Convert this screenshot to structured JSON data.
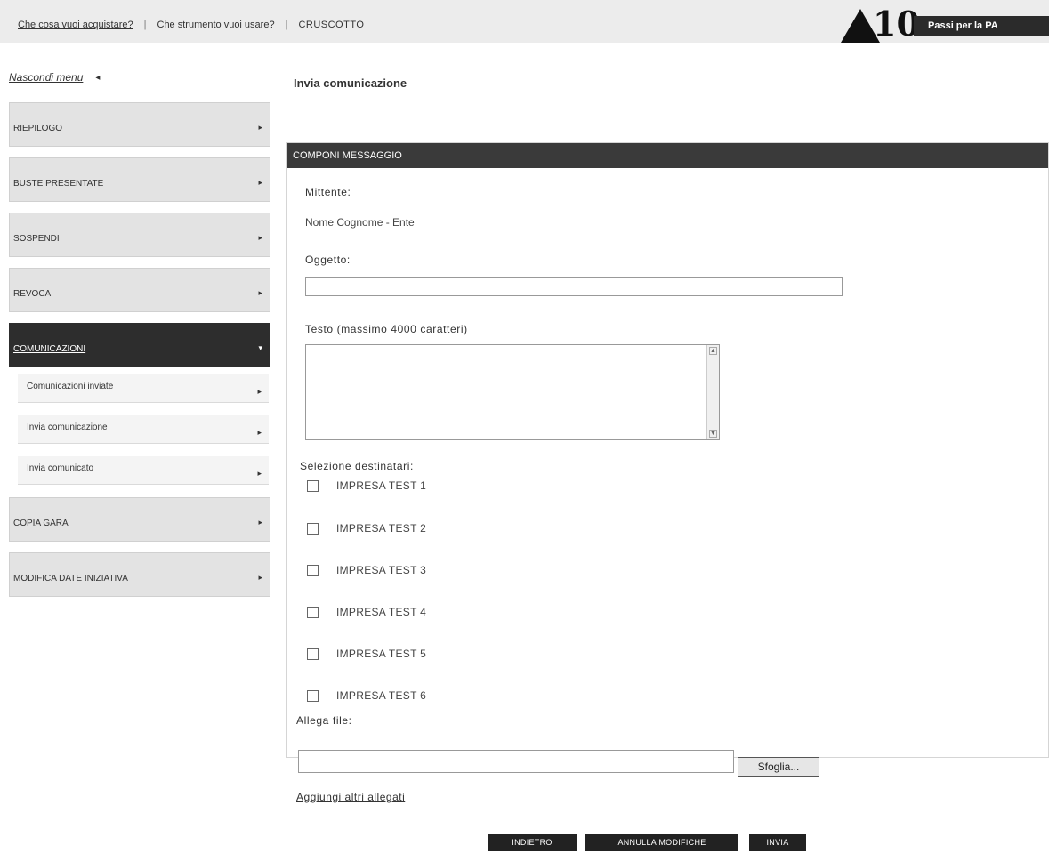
{
  "topnav": {
    "link1": "Che cosa vuoi acquistare?",
    "item2": "Che strumento vuoi usare?",
    "item3": "CRUSCOTTO",
    "separator": "|"
  },
  "logo": {
    "number": "10",
    "tagline": "Passi per la PA"
  },
  "hide_menu": {
    "label": "Nascondi menu",
    "arrow": "◂"
  },
  "sidebar": {
    "items": [
      {
        "label": "RIEPILOGO",
        "chevron": "▸"
      },
      {
        "label": "BUSTE PRESENTATE",
        "chevron": "▸"
      },
      {
        "label": "SOSPENDI",
        "chevron": "▸"
      },
      {
        "label": "REVOCA",
        "chevron": "▸"
      },
      {
        "label": "COMUNICAZIONI",
        "chevron": "▾"
      }
    ],
    "subitems": [
      {
        "label": "Comunicazioni inviate",
        "chevron": "▸"
      },
      {
        "label": "Invia comunicazione",
        "chevron": "▸"
      },
      {
        "label": "Invia comunicato",
        "chevron": "▸"
      }
    ],
    "items_after": [
      {
        "label": "COPIA GARA",
        "chevron": "▸"
      },
      {
        "label": "MODIFICA DATE INIZIATIVA",
        "chevron": "▸"
      }
    ]
  },
  "page": {
    "title": "Invia comunicazione"
  },
  "panel": {
    "header": "COMPONI MESSAGGIO",
    "sender_label": "Mittente:",
    "sender_value": "Nome Cognome - Ente",
    "subject_label": "Oggetto:",
    "subject_value": "",
    "body_label": "Testo (massimo 4000 caratteri)",
    "body_value": "",
    "recipients_label": "Selezione destinatari:",
    "recipients": [
      "IMPRESA TEST 1",
      "IMPRESA TEST 2",
      "IMPRESA TEST 3",
      "IMPRESA TEST 4",
      "IMPRESA TEST 5",
      "IMPRESA TEST 6"
    ],
    "attach_label": "Allega file:",
    "browse_label": "Sfoglia...",
    "add_attachments": "Aggiungi altri allegati"
  },
  "actions": {
    "back": "INDIETRO",
    "cancel": "ANNULLA MODIFICHE",
    "send": "INVIA"
  }
}
